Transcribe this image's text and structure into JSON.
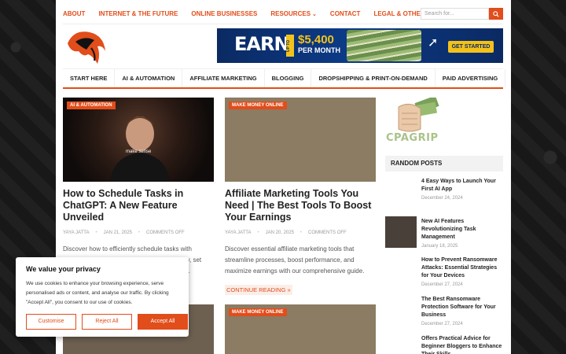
{
  "topnav": {
    "items": [
      "ABOUT",
      "INTERNET & THE FUTURE",
      "ONLINE BUSINESSES",
      "RESOURCES",
      "CONTACT",
      "LEGAL & OTHER POLICIES"
    ],
    "search_placeholder": "Search for..."
  },
  "ad": {
    "earn": "EARN",
    "upto": "UP TO",
    "amount": "$5,400",
    "per": "PER MONTH",
    "cta": "GET STARTED"
  },
  "mainnav": {
    "items": [
      "START HERE",
      "AI & AUTOMATION",
      "AFFILIATE MARKETING",
      "BLOGGING",
      "DROPSHIPPING & PRINT-ON-DEMAND",
      "PAID ADVERTISING"
    ]
  },
  "posts": [
    {
      "badge": "AI & AUTOMATION",
      "title": "How to Schedule Tasks in ChatGPT: A New Feature Unveiled",
      "author": "YAYA JATTA",
      "date": "JAN 21, 2025",
      "comments": "COMMENTS OFF",
      "excerpt": "Discover how to efficiently schedule tasks with ChatGPT's new feature! Enhance productivity, set reminders, and personalize your daily routine.",
      "caption": "make sense"
    },
    {
      "badge": "MAKE MONEY ONLINE",
      "title": "Affiliate Marketing Tools You Need | The Best Tools To Boost Your Earnings",
      "author": "YAYA JATTA",
      "date": "JAN 20, 2025",
      "comments": "COMMENTS OFF",
      "excerpt": "Discover essential affiliate marketing tools that streamline processes, boost performance, and maximize earnings with our comprehensive guide.",
      "more": "CONTINUE READING »"
    },
    {
      "badge": "MAKE MONEY ONLINE"
    }
  ],
  "sidebar": {
    "cpa_logo": "CPAGRIP",
    "title": "RANDOM POSTS",
    "items": [
      {
        "title": "4 Easy Ways to Launch Your First AI App",
        "date": "December 24, 2024"
      },
      {
        "title": "New AI Features Revolutionizing Task Management",
        "date": "January 18, 2025"
      },
      {
        "title": "How to Prevent Ransomware Attacks: Essential Strategies for Your Devices",
        "date": "December 27, 2024"
      },
      {
        "title": "The Best Ransomware Protection Software for Your Business",
        "date": "December 27, 2024"
      },
      {
        "title": "Offers Practical Advice for Beginner Bloggers to Enhance Their Skills",
        "date": ""
      }
    ]
  },
  "cookie": {
    "title": "We value your privacy",
    "text": "We use cookies to enhance your browsing experience, serve personalised ads or content, and analyse our traffic. By clicking \"Accept All\", you consent to our use of cookies.",
    "customise": "Customise",
    "reject": "Reject All",
    "accept": "Accept All"
  },
  "colors": {
    "accent": "#e14d1b",
    "background": "#1b1b1b"
  }
}
